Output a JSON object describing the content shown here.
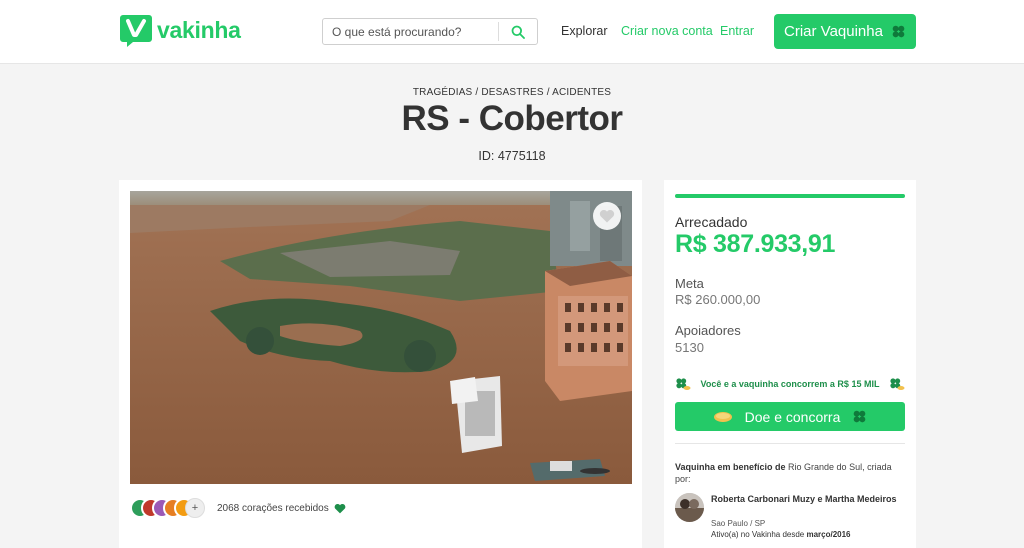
{
  "header": {
    "logo_text": "vakinha",
    "search_placeholder": "O que está procurando?",
    "nav": {
      "explorar": "Explorar",
      "criar_nova_conta": "Criar nova conta",
      "entrar": "Entrar"
    },
    "cta_label": "Criar Vaquinha"
  },
  "campaign": {
    "category": "TRAGÉDIAS / DESASTRES / ACIDENTES",
    "title": "RS - Cobertor",
    "id_text": "ID: 4775118",
    "hearts_text": "2068 corações recebidos"
  },
  "sidebar": {
    "progress_fraction": 1.0,
    "raised_label": "Arrecadado",
    "raised_value": "R$ 387.933,91",
    "meta_label": "Meta",
    "meta_value": "R$ 260.000,00",
    "supporters_label": "Apoiadores",
    "supporters_value": "5130",
    "promo_text": "Você e a vaquinha concorrem a R$ 15 MIL",
    "donate_label": "Doe e concorra",
    "beneficiary_bold": "Vaquinha em benefício de",
    "beneficiary_rest": " Rio Grande do Sul, criada por:",
    "organizer_name": "Roberta Carbonari Muzy e Martha Medeiros",
    "organizer_city": "Sao Paulo / SP",
    "organizer_active_prefix": "Ativo(a) no Vakinha desde ",
    "organizer_active_date": "março/2016"
  },
  "colors": {
    "brand_green": "#24ca68",
    "dark_green": "#1e8f4b",
    "avatar_colors": [
      "#2e9e5b",
      "#c0392b",
      "#9b59b6",
      "#e67e22",
      "#f39c12"
    ]
  }
}
